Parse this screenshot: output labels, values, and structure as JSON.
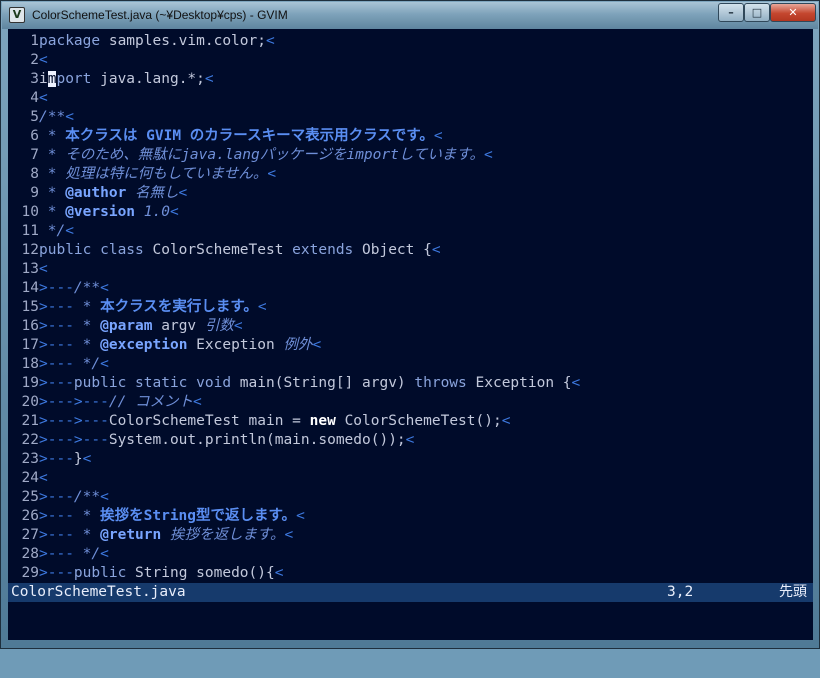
{
  "window": {
    "title": "ColorSchemeTest.java (~¥Desktop¥cps) - GVIM",
    "app_icon": "vim-icon",
    "buttons": {
      "minimize": "–",
      "maximize": "□",
      "close": "✕"
    }
  },
  "editor": {
    "colors": {
      "background": "#000b2a",
      "line_number": "#9fa9c6",
      "comment": "#6f8fd8",
      "keyword": "#8aa4dd",
      "listchars": "#3d79e0",
      "statusline_bg": "#163a6c"
    },
    "lines": [
      {
        "n": "1",
        "segs": [
          [
            "kw",
            "package"
          ],
          [
            "t",
            " samples.vim.color;"
          ],
          [
            "eol",
            "<"
          ]
        ]
      },
      {
        "n": "2",
        "segs": [
          [
            "eol",
            "<"
          ]
        ]
      },
      {
        "n": "3",
        "segs": [
          [
            "t",
            "i"
          ],
          [
            "cursor",
            "m"
          ],
          [
            "kw",
            "port"
          ],
          [
            "t",
            " java.lang.*;"
          ],
          [
            "eol",
            "<"
          ]
        ]
      },
      {
        "n": "4",
        "segs": [
          [
            "eol",
            "<"
          ]
        ]
      },
      {
        "n": "5",
        "segs": [
          [
            "cm",
            "/**"
          ],
          [
            "eol",
            "<"
          ]
        ]
      },
      {
        "n": "6",
        "segs": [
          [
            "cm",
            " * "
          ],
          [
            "cmb",
            "本クラスは GVIM のカラースキーマ表示用クラスです。"
          ],
          [
            "eol",
            "<"
          ]
        ]
      },
      {
        "n": "7",
        "segs": [
          [
            "cm",
            " * そのため、無駄にjava.langパッケージをimportしています。"
          ],
          [
            "eol",
            "<"
          ]
        ]
      },
      {
        "n": "8",
        "segs": [
          [
            "cm",
            " * 処理は特に何もしていません。"
          ],
          [
            "eol",
            "<"
          ]
        ]
      },
      {
        "n": "9",
        "segs": [
          [
            "cm",
            " * "
          ],
          [
            "tag",
            "@author"
          ],
          [
            "cm",
            " 名無し"
          ],
          [
            "eol",
            "<"
          ]
        ]
      },
      {
        "n": "10",
        "segs": [
          [
            "cm",
            " * "
          ],
          [
            "tag",
            "@version"
          ],
          [
            "cm",
            " 1.0"
          ],
          [
            "eol",
            "<"
          ]
        ]
      },
      {
        "n": "11",
        "segs": [
          [
            "cm",
            " */"
          ],
          [
            "eol",
            "<"
          ]
        ]
      },
      {
        "n": "12",
        "segs": [
          [
            "kw",
            "public class"
          ],
          [
            "t",
            " ColorSchemeTest "
          ],
          [
            "kw",
            "extends"
          ],
          [
            "t",
            " Object {"
          ],
          [
            "eol",
            "<"
          ]
        ]
      },
      {
        "n": "13",
        "segs": [
          [
            "eol",
            "<"
          ]
        ]
      },
      {
        "n": "14",
        "segs": [
          [
            "ws",
            ">---"
          ],
          [
            "cm",
            "/**"
          ],
          [
            "eol",
            "<"
          ]
        ]
      },
      {
        "n": "15",
        "segs": [
          [
            "ws",
            ">---"
          ],
          [
            "cm",
            " * "
          ],
          [
            "cmb",
            "本クラスを実行します。"
          ],
          [
            "eol",
            "<"
          ]
        ]
      },
      {
        "n": "16",
        "segs": [
          [
            "ws",
            ">---"
          ],
          [
            "cm",
            " * "
          ],
          [
            "tag",
            "@param"
          ],
          [
            "t",
            " argv "
          ],
          [
            "cm",
            "引数"
          ],
          [
            "eol",
            "<"
          ]
        ]
      },
      {
        "n": "17",
        "segs": [
          [
            "ws",
            ">---"
          ],
          [
            "cm",
            " * "
          ],
          [
            "tag",
            "@exception"
          ],
          [
            "t",
            " Exception "
          ],
          [
            "cm",
            "例外"
          ],
          [
            "eol",
            "<"
          ]
        ]
      },
      {
        "n": "18",
        "segs": [
          [
            "ws",
            ">---"
          ],
          [
            "cm",
            " */"
          ],
          [
            "eol",
            "<"
          ]
        ]
      },
      {
        "n": "19",
        "segs": [
          [
            "ws",
            ">---"
          ],
          [
            "kw",
            "public static void"
          ],
          [
            "t",
            " main(String[] argv) "
          ],
          [
            "kw",
            "throws"
          ],
          [
            "t",
            " Exception {"
          ],
          [
            "eol",
            "<"
          ]
        ]
      },
      {
        "n": "20",
        "segs": [
          [
            "ws",
            ">--->---"
          ],
          [
            "cm",
            "// コメント"
          ],
          [
            "eol",
            "<"
          ]
        ]
      },
      {
        "n": "21",
        "segs": [
          [
            "ws",
            ">--->---"
          ],
          [
            "t",
            "ColorSchemeTest main = "
          ],
          [
            "new",
            "new"
          ],
          [
            "t",
            " ColorSchemeTest();"
          ],
          [
            "eol",
            "<"
          ]
        ]
      },
      {
        "n": "22",
        "segs": [
          [
            "ws",
            ">--->---"
          ],
          [
            "t",
            "System.out.println(main.somedo());"
          ],
          [
            "eol",
            "<"
          ]
        ]
      },
      {
        "n": "23",
        "segs": [
          [
            "ws",
            ">---"
          ],
          [
            "t",
            "}"
          ],
          [
            "eol",
            "<"
          ]
        ]
      },
      {
        "n": "24",
        "segs": [
          [
            "eol",
            "<"
          ]
        ]
      },
      {
        "n": "25",
        "segs": [
          [
            "ws",
            ">---"
          ],
          [
            "cm",
            "/**"
          ],
          [
            "eol",
            "<"
          ]
        ]
      },
      {
        "n": "26",
        "segs": [
          [
            "ws",
            ">---"
          ],
          [
            "cm",
            " * "
          ],
          [
            "cmb",
            "挨拶をString型で返します。"
          ],
          [
            "eol",
            "<"
          ]
        ]
      },
      {
        "n": "27",
        "segs": [
          [
            "ws",
            ">---"
          ],
          [
            "cm",
            " * "
          ],
          [
            "tag",
            "@return"
          ],
          [
            "cm",
            " 挨拶を返します。"
          ],
          [
            "eol",
            "<"
          ]
        ]
      },
      {
        "n": "28",
        "segs": [
          [
            "ws",
            ">---"
          ],
          [
            "cm",
            " */"
          ],
          [
            "eol",
            "<"
          ]
        ]
      },
      {
        "n": "29",
        "segs": [
          [
            "ws",
            ">---"
          ],
          [
            "kw",
            "public"
          ],
          [
            "t",
            " String somedo(){"
          ],
          [
            "eol",
            "<"
          ]
        ]
      }
    ]
  },
  "statusline": {
    "filename": "ColorSchemeTest.java",
    "position": "3,2",
    "scroll": "先頭"
  },
  "cmdline": {
    "text": ""
  }
}
